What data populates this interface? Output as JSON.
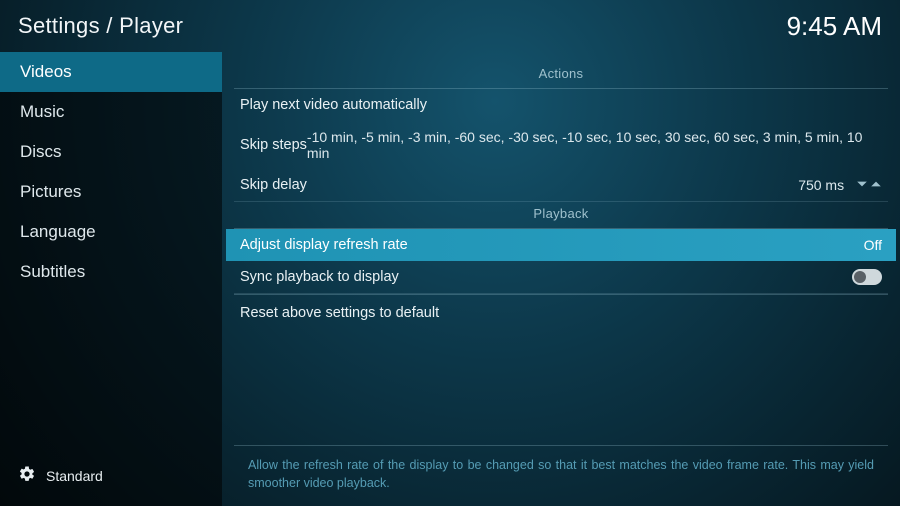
{
  "header": {
    "title": "Settings / Player",
    "clock": "9:45 AM"
  },
  "sidebar": {
    "items": [
      {
        "label": "Videos",
        "active": true
      },
      {
        "label": "Music",
        "active": false
      },
      {
        "label": "Discs",
        "active": false
      },
      {
        "label": "Pictures",
        "active": false
      },
      {
        "label": "Language",
        "active": false
      },
      {
        "label": "Subtitles",
        "active": false
      }
    ],
    "level": "Standard"
  },
  "sections": {
    "actions": {
      "title": "Actions",
      "play_next": "Play next video automatically",
      "skip_steps_label": "Skip steps",
      "skip_steps_value": "-10 min, -5 min, -3 min, -60 sec, -30 sec, -10 sec, 10 sec, 30 sec, 60 sec, 3 min, 5 min, 10 min",
      "skip_delay_label": "Skip delay",
      "skip_delay_value": "750 ms"
    },
    "playback": {
      "title": "Playback",
      "adjust_refresh_label": "Adjust display refresh rate",
      "adjust_refresh_value": "Off",
      "sync_label": "Sync playback to display",
      "sync_enabled": false,
      "reset_label": "Reset above settings to default"
    }
  },
  "help": "Allow the refresh rate of the display to be changed so that it best matches the video frame rate. This may yield smoother video playback."
}
